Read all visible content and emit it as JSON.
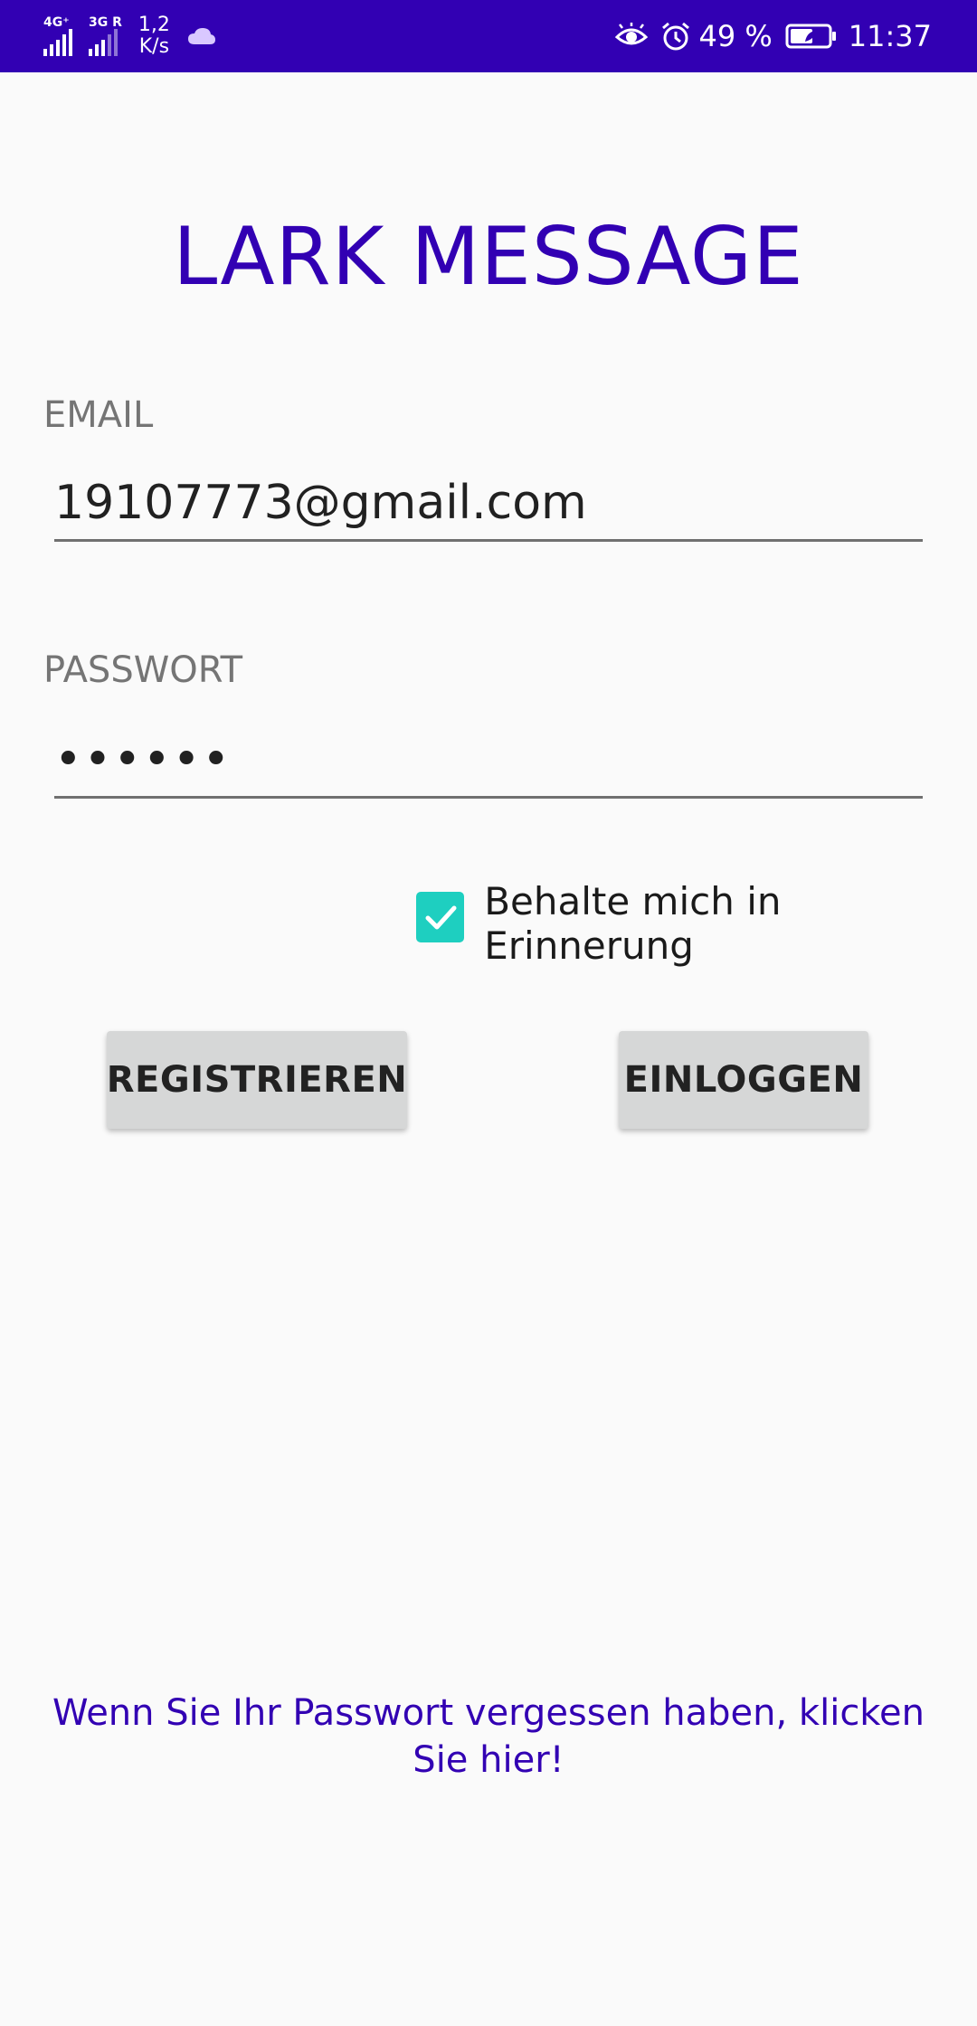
{
  "status_bar": {
    "sim1_tech": "4G⁺",
    "sim2_tech": "3G R",
    "net_speed_value": "1,2",
    "net_speed_unit": "K/s",
    "battery_percent": "49 %",
    "time": "11:37",
    "icons": [
      "signal-icon",
      "cloud-icon",
      "eye-icon",
      "alarm-icon",
      "battery-icon"
    ]
  },
  "app": {
    "title": "LARK MESSAGE"
  },
  "form": {
    "email_label": "EMAIL",
    "email_value": "19107773@gmail.com",
    "password_label": "PASSWORT",
    "password_value": "••••••",
    "remember_label": "Behalte mich in Erinnerung",
    "remember_checked": true
  },
  "buttons": {
    "register_label": "REGISTRIEREN",
    "login_label": "EINLOGGEN"
  },
  "footer": {
    "forgot_text": "Wenn Sie Ihr Passwort vergessen haben, klicken Sie hier!"
  },
  "colors": {
    "primary": "#3200b3",
    "checkbox": "#1ecfc0",
    "button_bg": "#d6d7d7"
  }
}
